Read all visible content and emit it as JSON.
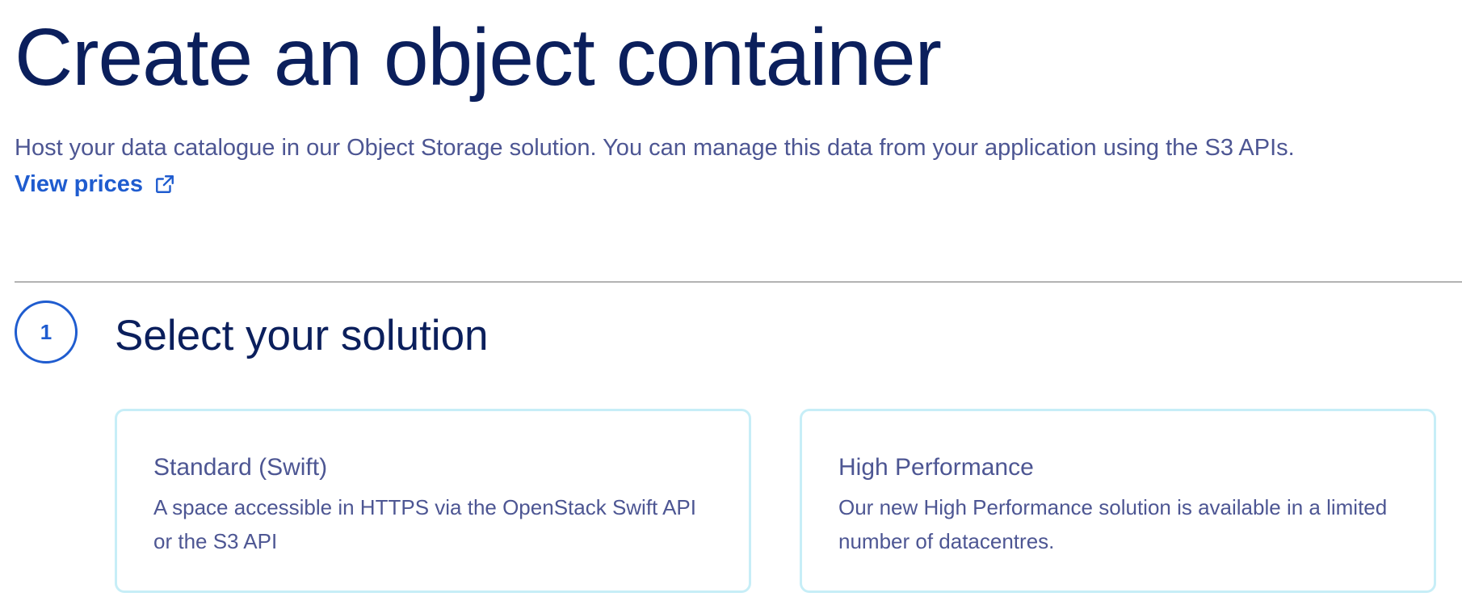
{
  "header": {
    "title": "Create an object container",
    "description": "Host your data catalogue in our Object Storage solution. You can manage this data from your application using the S3 APIs.",
    "prices_link_label": "View prices",
    "prices_link_icon": "external-link-icon"
  },
  "colors": {
    "title": "#0b1f5c",
    "body_text": "#4d5693",
    "link": "#1f5ccf",
    "card_border": "#c7eef7",
    "divider": "#b3b3b3"
  },
  "step": {
    "number": "1",
    "title": "Select your solution"
  },
  "solutions": [
    {
      "title": "Standard (Swift)",
      "description": "A space accessible in HTTPS via the OpenStack Swift API or the S3 API"
    },
    {
      "title": "High Performance",
      "description": "Our new High Performance solution is available in a limited number of datacentres."
    }
  ]
}
